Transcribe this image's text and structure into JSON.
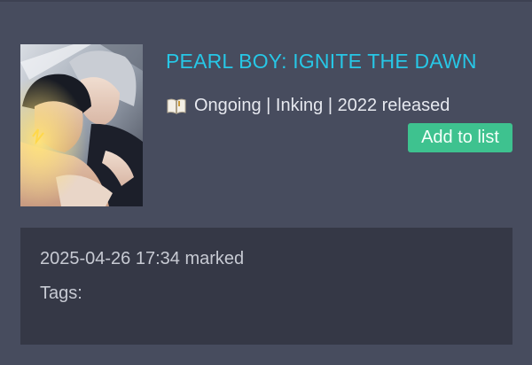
{
  "entry": {
    "title": "PEARL BOY: IGNITE THE DAWN",
    "status_icon": "book-icon",
    "status_text": "Ongoing | Inking | 2022 released",
    "add_button_label": "Add to list"
  },
  "details": {
    "marked_text": "2025-04-26 17:34 marked",
    "tags_label": "Tags:"
  },
  "colors": {
    "background": "#474c5e",
    "title": "#27c7e6",
    "button": "#3ec28f",
    "panel": "#353846"
  }
}
